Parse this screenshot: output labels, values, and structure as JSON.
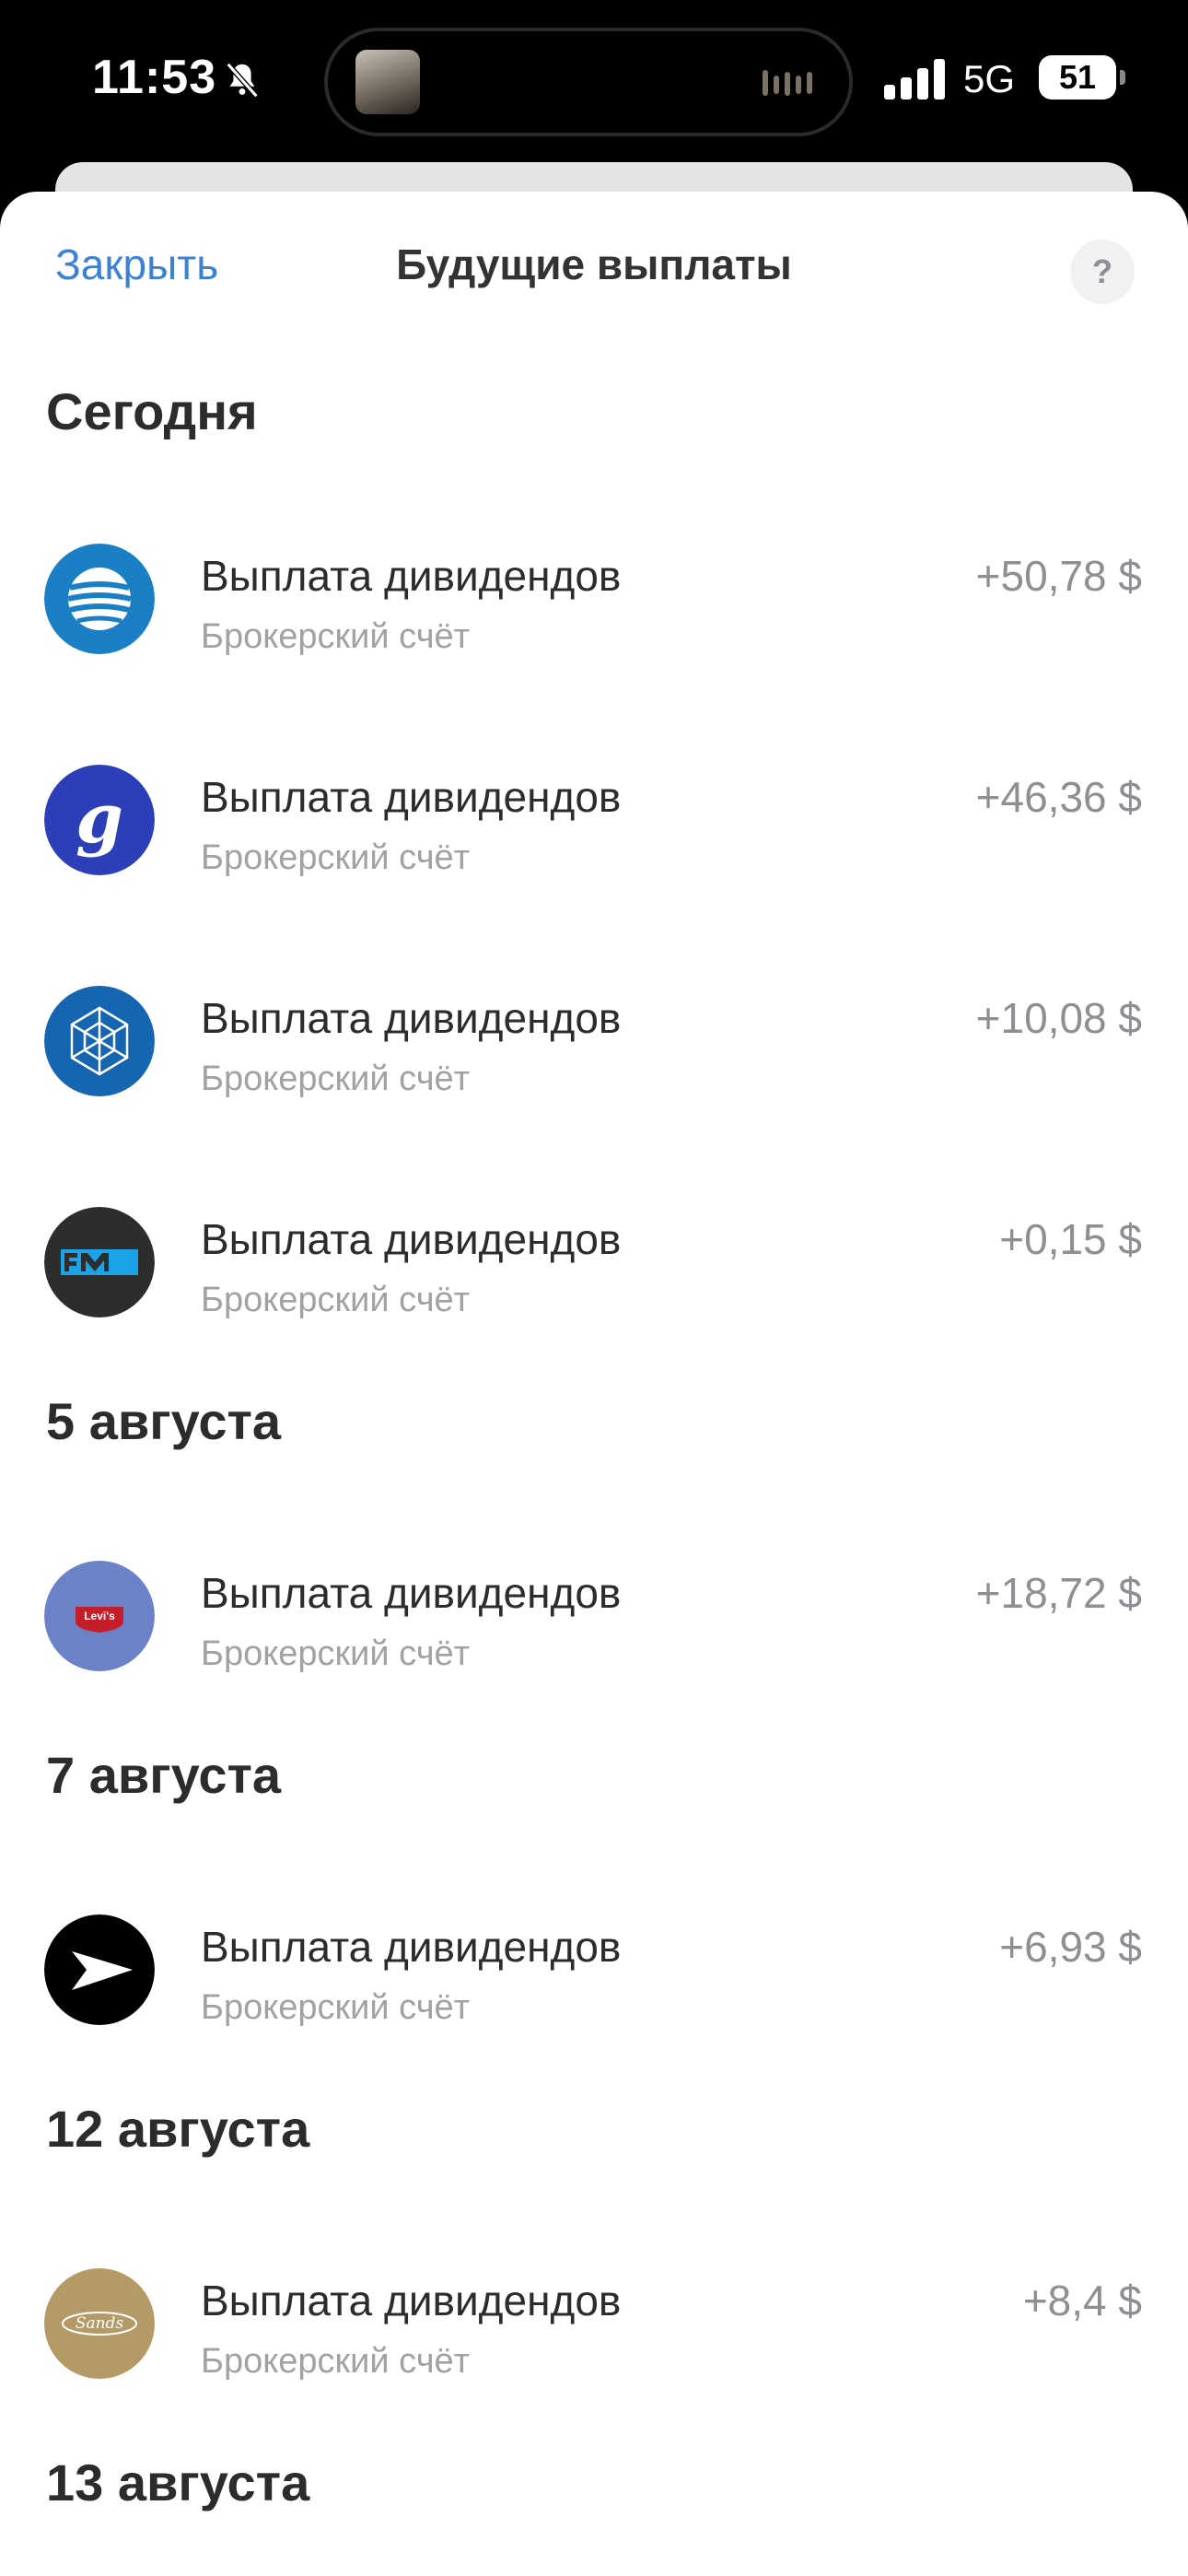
{
  "status_bar": {
    "time": "11:53",
    "network": "5G",
    "battery": "51"
  },
  "header": {
    "close_label": "Закрыть",
    "title": "Будущие выплаты",
    "help_label": "?"
  },
  "sections": [
    {
      "title": "Сегодня",
      "items": [
        {
          "title": "Выплата дивидендов",
          "subtitle": "Брокерский счёт",
          "amount": "+50,78 $",
          "logo": "att-logo"
        },
        {
          "title": "Выплата дивидендов",
          "subtitle": "Брокерский счёт",
          "amount": "+46,36 $",
          "logo": "general-mills-logo"
        },
        {
          "title": "Выплата дивидендов",
          "subtitle": "Брокерский счёт",
          "amount": "+10,08 $",
          "logo": "star-logo"
        },
        {
          "title": "Выплата дивидендов",
          "subtitle": "Брокерский счёт",
          "amount": "+0,15 $",
          "logo": "fm-logo"
        }
      ]
    },
    {
      "title": "5 августа",
      "items": [
        {
          "title": "Выплата дивидендов",
          "subtitle": "Брокерский счёт",
          "amount": "+18,72 $",
          "logo": "levis-logo",
          "logo_text": "Levi's"
        }
      ]
    },
    {
      "title": "7 августа",
      "items": [
        {
          "title": "Выплата дивидендов",
          "subtitle": "Брокерский счёт",
          "amount": "+6,93 $",
          "logo": "arrow-logo"
        }
      ]
    },
    {
      "title": "12 августа",
      "items": [
        {
          "title": "Выплата дивидендов",
          "subtitle": "Брокерский счёт",
          "amount": "+8,4 $",
          "logo": "sands-logo",
          "logo_text": "Sands"
        }
      ]
    },
    {
      "title": "13 августа",
      "items": []
    }
  ],
  "colors": {
    "accent": "#3b82d6",
    "text_primary": "#2c2c2e",
    "text_secondary": "#a1a1a6",
    "amount": "#8e8e93"
  }
}
